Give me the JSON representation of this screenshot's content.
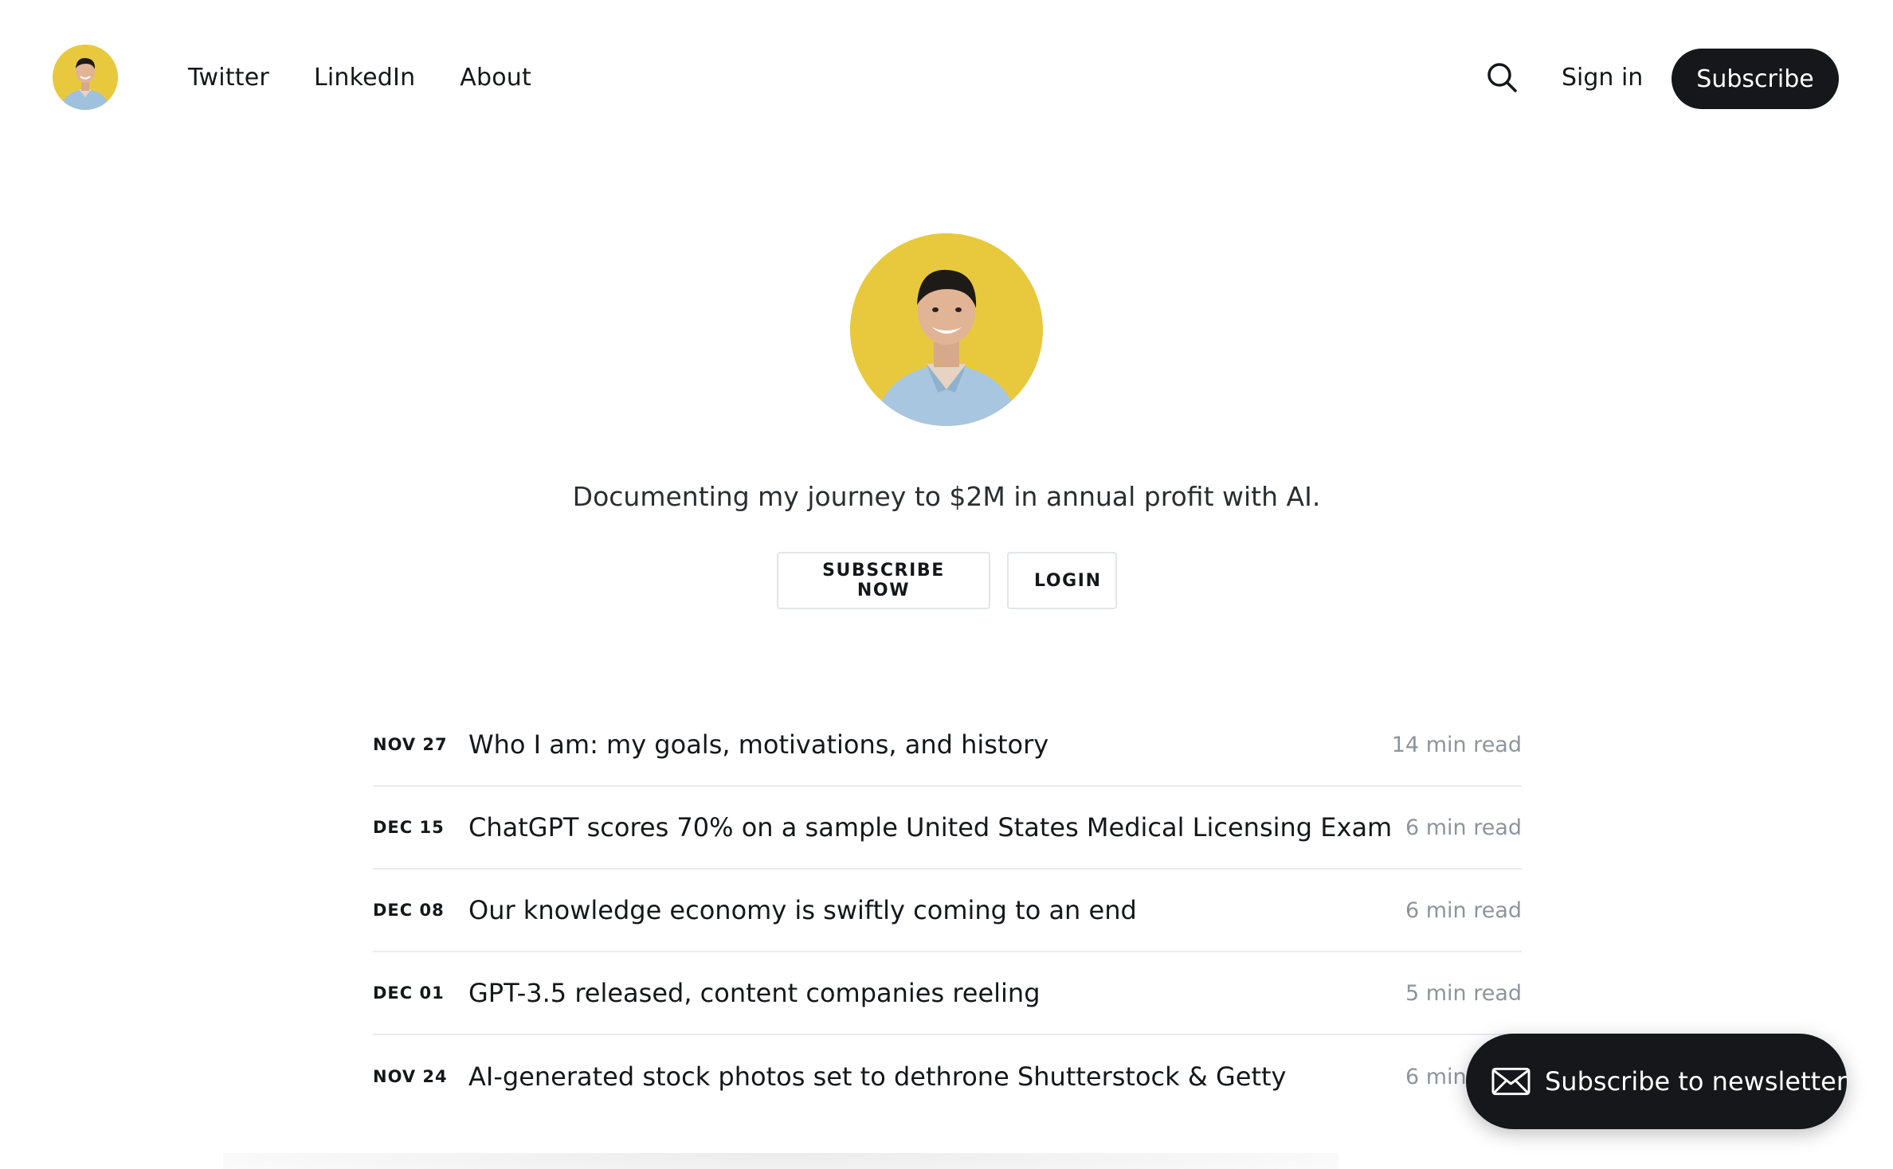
{
  "header": {
    "logo_icon": "avatar-icon",
    "nav": [
      {
        "label": "Twitter"
      },
      {
        "label": "LinkedIn"
      },
      {
        "label": "About"
      }
    ],
    "search_icon": "search-icon",
    "signin_label": "Sign in",
    "subscribe_label": "Subscribe"
  },
  "hero": {
    "avatar_icon": "avatar-icon",
    "tagline": "Documenting my journey to $2M in annual profit with AI.",
    "subscribe_now_label": "SUBSCRIBE NOW",
    "login_label": "LOGIN"
  },
  "posts": [
    {
      "date": "NOV 27",
      "title": "Who I am: my goals, motivations, and history",
      "read": "14 min read"
    },
    {
      "date": "DEC 15",
      "title": "ChatGPT scores 70% on a sample United States Medical Licensing Exam",
      "read": "6 min read"
    },
    {
      "date": "DEC 08",
      "title": "Our knowledge economy is swiftly coming to an end",
      "read": "6 min read"
    },
    {
      "date": "DEC 01",
      "title": "GPT-3.5 released, content companies reeling",
      "read": "5 min read"
    },
    {
      "date": "NOV 24",
      "title": "AI-generated stock photos set to dethrone Shutterstock & Getty",
      "read": "6 min read"
    }
  ],
  "newsletter": {
    "label": "Subscribe to newsletter",
    "icon": "envelope-icon"
  },
  "colors": {
    "accent_yellow": "#e8c93e",
    "dark": "#15171a",
    "muted": "#8e949c",
    "divider": "#e9ebee"
  }
}
